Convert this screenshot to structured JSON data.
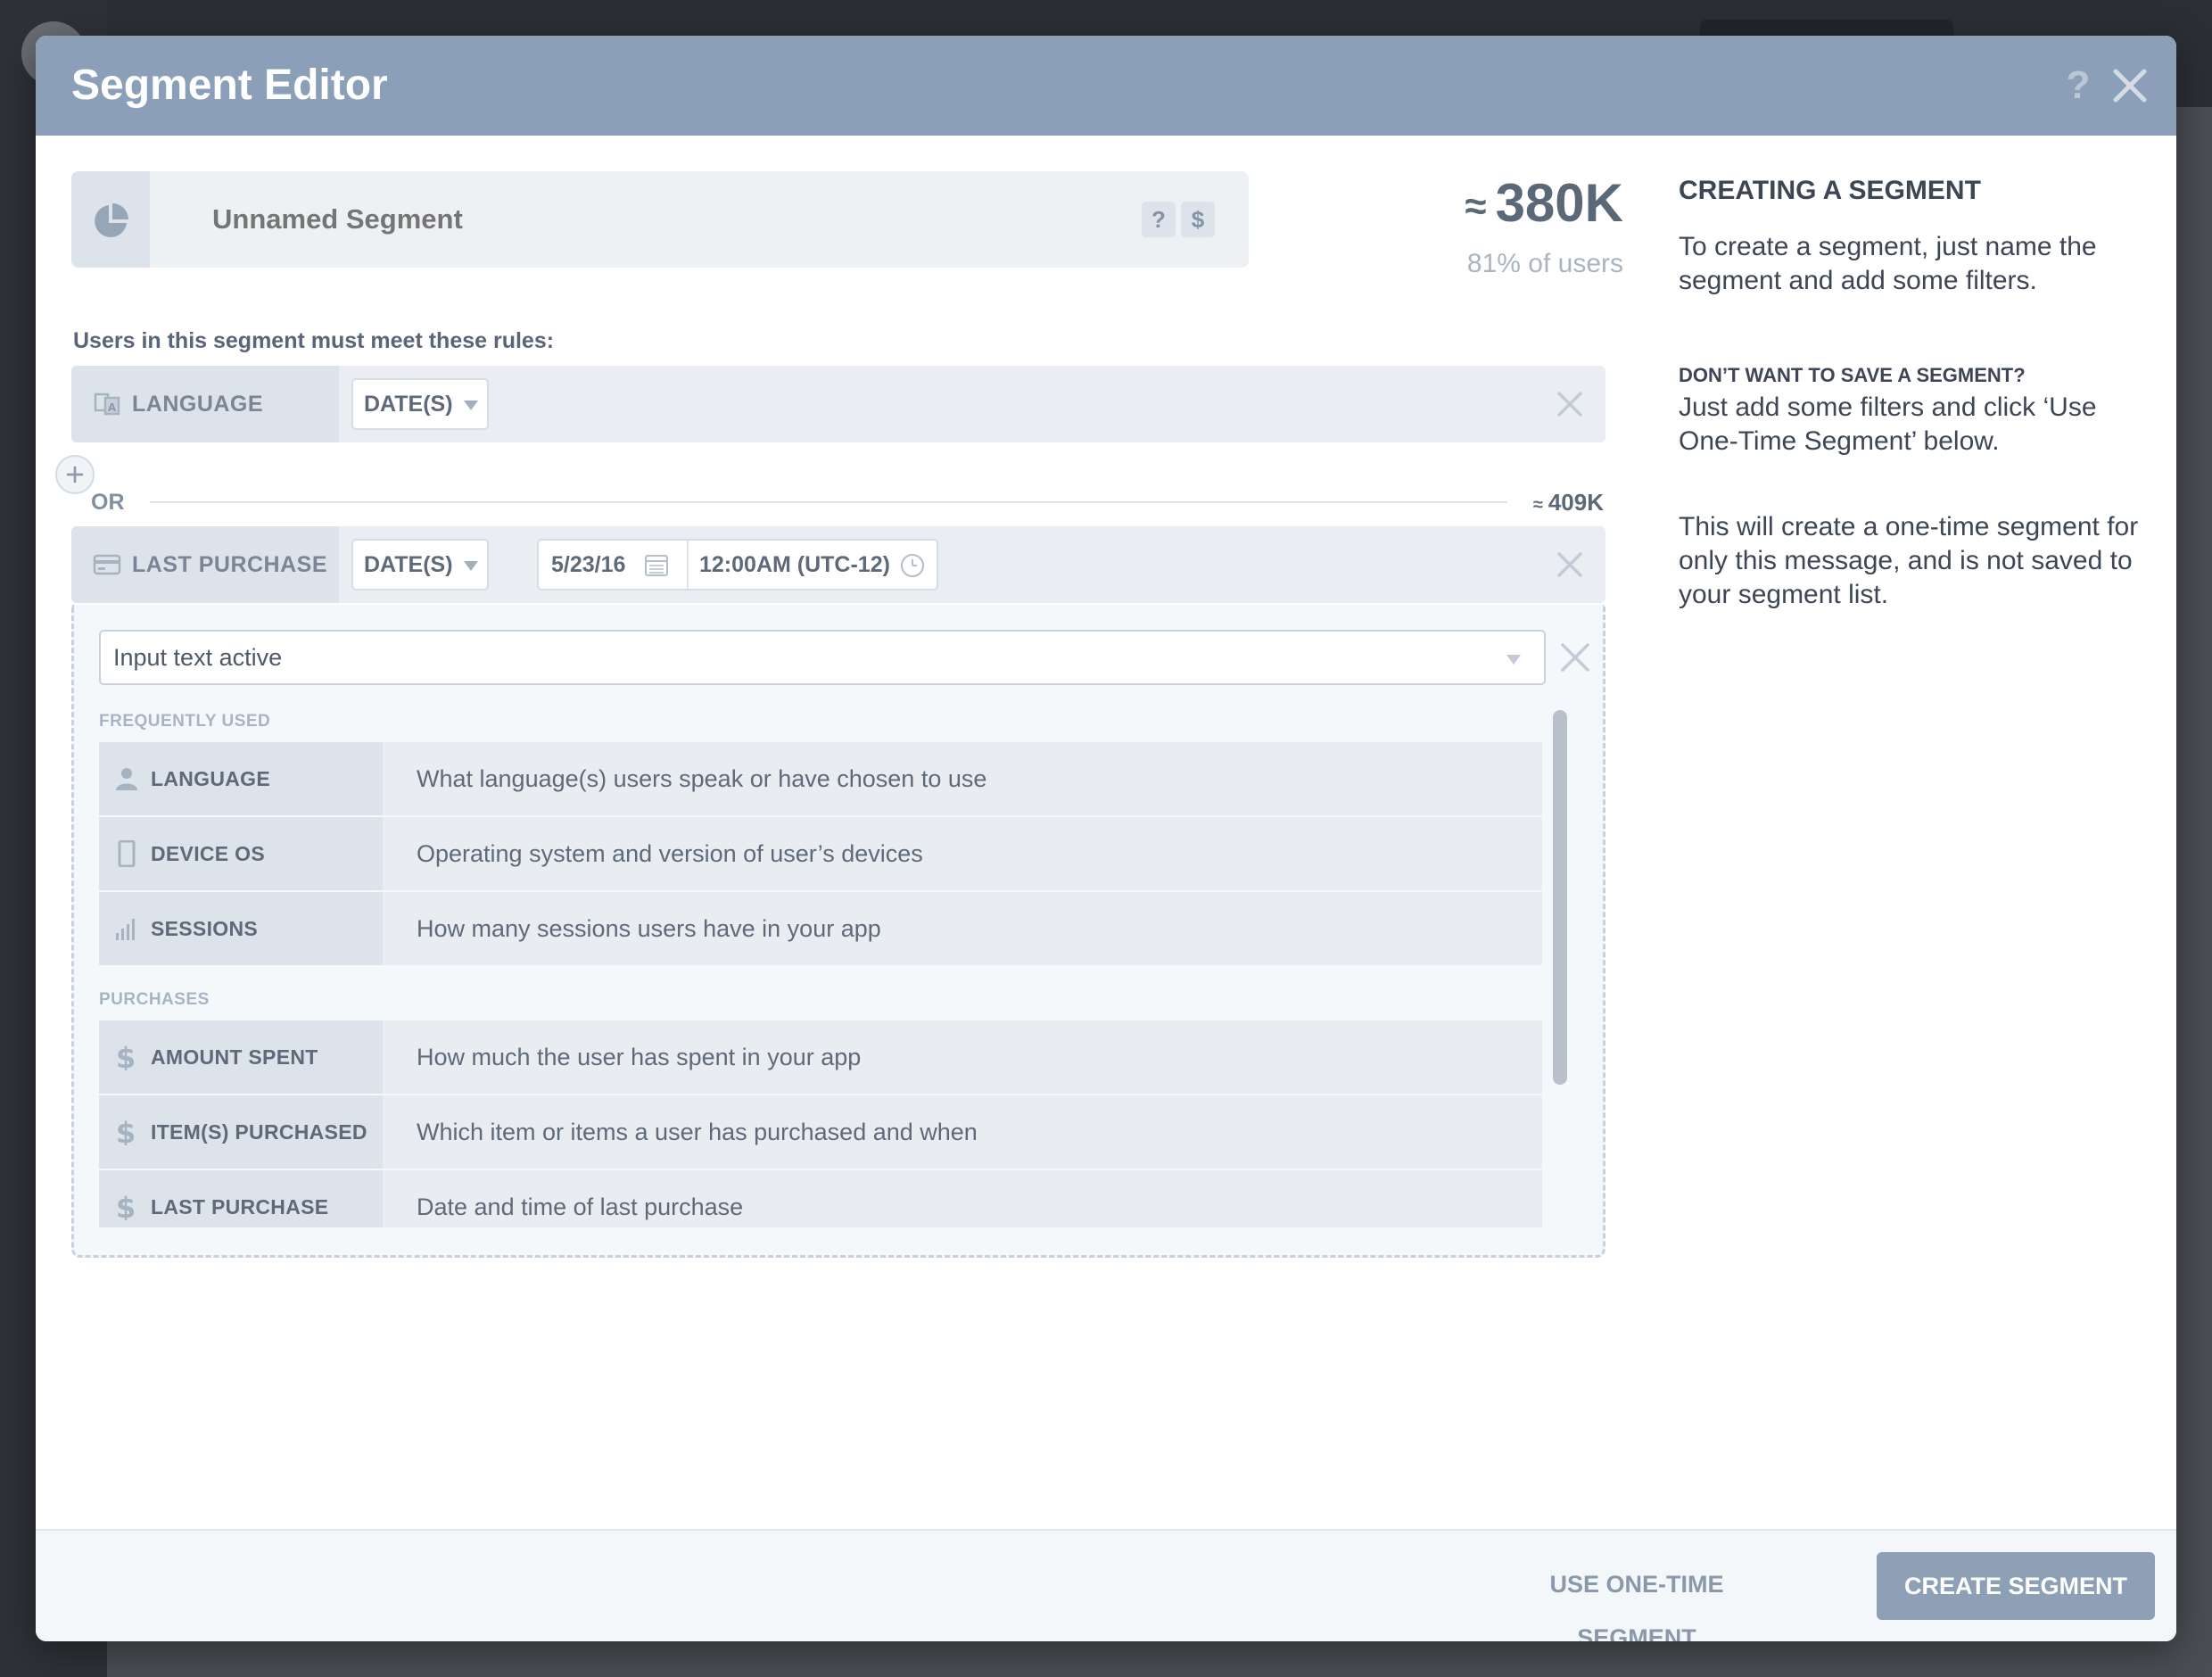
{
  "modal": {
    "title": "Segment Editor",
    "help_label": "?"
  },
  "segment": {
    "name_placeholder": "Unnamed Segment",
    "mini_icons": [
      "?",
      "$"
    ],
    "approx_symbol": "≈",
    "count": "380K",
    "percent_text": "81% of users",
    "rules_label": "Users in this segment must meet these rules:"
  },
  "rules": [
    {
      "key": "LANGUAGE",
      "icon": "language-icon",
      "operator": "DATE(S)"
    },
    {
      "key": "LAST PURCHASE",
      "icon": "credit-card-icon",
      "operator": "DATE(S)",
      "date": "5/23/16",
      "time": "12:00AM  (UTC-12)"
    }
  ],
  "or_group": {
    "label": "OR",
    "approx_symbol": "≈",
    "count": "409K"
  },
  "filter_panel": {
    "search_value": "Input text active",
    "groups": [
      {
        "title": "FREQUENTLY USED",
        "items": [
          {
            "label": "LANGUAGE",
            "icon": "person-icon",
            "description": "What language(s) users speak or have chosen to use"
          },
          {
            "label": "DEVICE OS",
            "icon": "phone-icon",
            "description": "Operating system and version of user’s devices"
          },
          {
            "label": "SESSIONS",
            "icon": "bar-chart-icon",
            "description": "How many sessions users have in your app"
          }
        ]
      },
      {
        "title": "PURCHASES",
        "items": [
          {
            "label": "AMOUNT SPENT",
            "icon": "dollar-icon",
            "description": "How much the user has spent in your app"
          },
          {
            "label": "ITEM(S) PURCHASED",
            "icon": "dollar-icon",
            "description": "Which item or items a user has purchased and when"
          },
          {
            "label": "LAST PURCHASE",
            "icon": "dollar-icon",
            "description": "Date and time of last purchase"
          }
        ]
      }
    ]
  },
  "help": {
    "title": "CREATING A SEGMENT",
    "intro": "To create a segment, just name the segment and add some filters.",
    "sub_title": "DON’T WANT TO SAVE A SEGMENT?",
    "sub_text": "Just add some filters and click ‘Use One-Time Segment’ below.",
    "note": "This will create a one-time segment for only this message, and is not saved to your segment list."
  },
  "footer": {
    "one_time_label": "USE ONE-TIME SEGMENT",
    "create_label": "CREATE SEGMENT"
  },
  "colors": {
    "header": "#8ba0b8",
    "primary_button": "#8da0b6",
    "text_dark": "#3d4654"
  }
}
